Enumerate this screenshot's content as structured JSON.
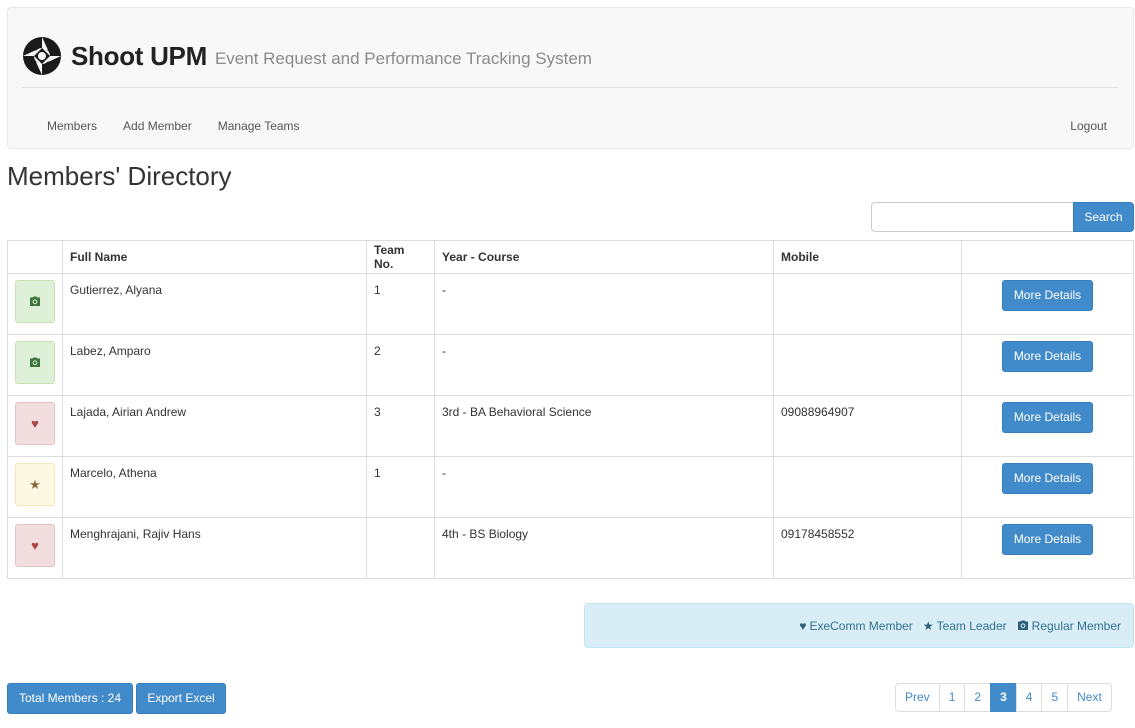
{
  "app": {
    "brand_title": "Shoot UPM",
    "brand_subtitle": "Event Request and Performance Tracking System"
  },
  "nav": {
    "links": [
      "Members",
      "Add Member",
      "Manage Teams"
    ],
    "logout": "Logout"
  },
  "page": {
    "title": "Members' Directory"
  },
  "search": {
    "value": "",
    "placeholder": "",
    "button_label": "Search"
  },
  "table": {
    "headers": [
      "",
      "Full Name",
      "Team No.",
      "Year - Course",
      "Mobile",
      ""
    ],
    "rows": [
      {
        "role": "regular",
        "name": "Gutierrez, Alyana",
        "team": "1",
        "year_course": "-",
        "mobile": "",
        "action": "More Details"
      },
      {
        "role": "regular",
        "name": "Labez, Amparo",
        "team": "2",
        "year_course": "-",
        "mobile": "",
        "action": "More Details"
      },
      {
        "role": "exec",
        "name": "Lajada, Airian Andrew",
        "team": "3",
        "year_course": "3rd - BA Behavioral Science",
        "mobile": "09088964907",
        "action": "More Details"
      },
      {
        "role": "leader",
        "name": "Marcelo, Athena",
        "team": "1",
        "year_course": "-",
        "mobile": "",
        "action": "More Details"
      },
      {
        "role": "exec",
        "name": "Menghrajani, Rajiv Hans",
        "team": "",
        "year_course": "4th - BS Biology",
        "mobile": "09178458552",
        "action": "More Details"
      }
    ]
  },
  "legend": {
    "exec": "ExeComm Member",
    "leader": "Team Leader",
    "regular": "Regular Member"
  },
  "footer": {
    "total_label": "Total Members : 24",
    "export_label": "Export Excel"
  },
  "pagination": {
    "prev": "Prev",
    "pages": [
      "1",
      "2",
      "3",
      "4",
      "5"
    ],
    "current": "3",
    "next": "Next"
  },
  "colors": {
    "primary": "#428bca",
    "regular_bg": "#dff0d8",
    "exec_bg": "#f2dede",
    "leader_bg": "#fcf8e3",
    "legend_bg": "#d9edf7"
  },
  "icons": {
    "regular": "camera-icon",
    "exec": "heart-icon",
    "leader": "star-icon"
  }
}
